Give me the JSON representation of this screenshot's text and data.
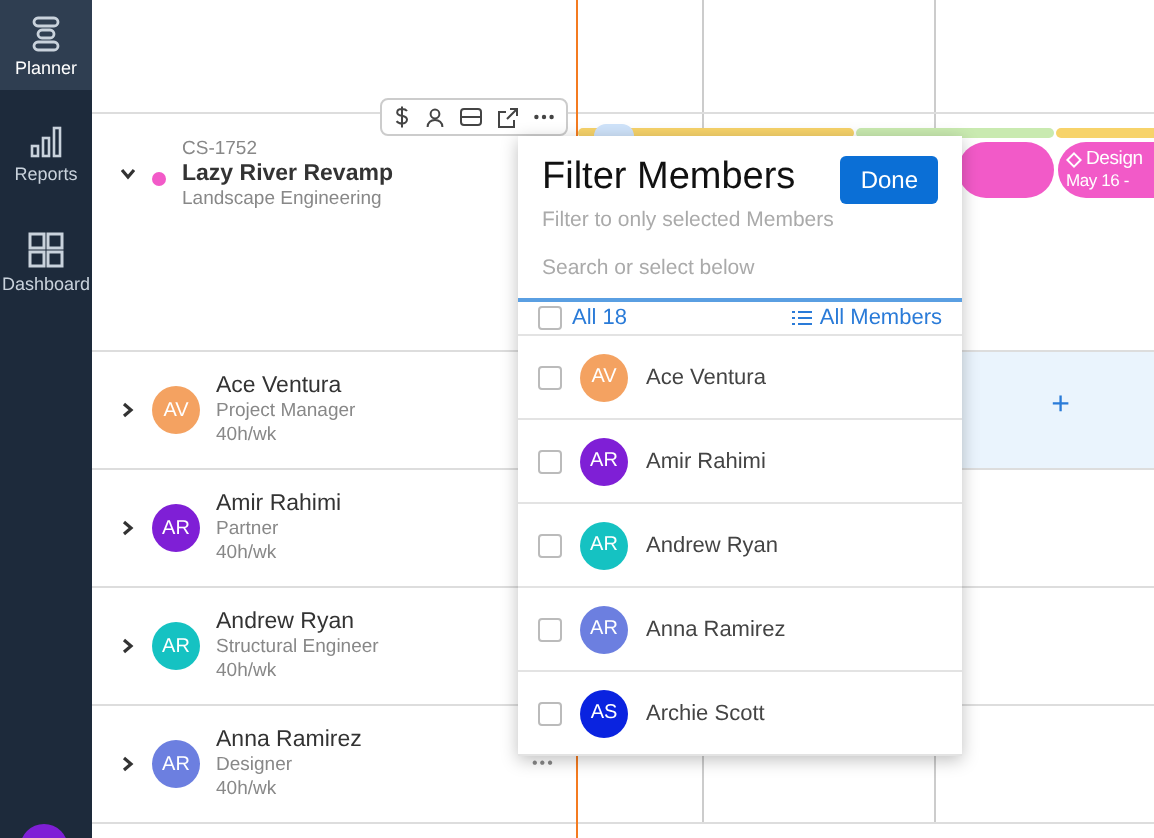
{
  "sidebar": {
    "items": [
      {
        "label": "Planner",
        "kind": "planner",
        "selected": true
      },
      {
        "label": "Reports",
        "kind": "reports",
        "selected": false
      },
      {
        "label": "Dashboard",
        "kind": "dashboard",
        "selected": false
      }
    ]
  },
  "project": {
    "code": "CS-1752",
    "name": "Lazy River Revamp",
    "client": "Landscape Engineering",
    "color": "#f25ac8",
    "expanded": true
  },
  "timeline": {
    "phases": [
      {
        "color": "#f7d36a"
      },
      {
        "color": "#c9eab0"
      },
      {
        "color": "#f7d36a"
      }
    ],
    "schedule_bar": {
      "label": "Design",
      "date": "May 16 -"
    }
  },
  "members": [
    {
      "initials": "AV",
      "name": "Ace Ventura",
      "role": "Project Manager",
      "capacity": "40h/wk",
      "color": "#f4a261",
      "expanded": false,
      "add_label": "+"
    },
    {
      "initials": "AR",
      "name": "Amir Rahimi",
      "role": "Partner",
      "capacity": "40h/wk",
      "color": "#7f1fd6",
      "expanded": false
    },
    {
      "initials": "AR",
      "name": "Andrew Ryan",
      "role": "Structural Engineer",
      "capacity": "40h/wk",
      "color": "#15c2c2",
      "expanded": false
    },
    {
      "initials": "AR",
      "name": "Anna Ramirez",
      "role": "Designer",
      "capacity": "40h/wk",
      "color": "#6c7fe0",
      "expanded": false,
      "more": "•••"
    }
  ],
  "filter": {
    "title": "Filter Members",
    "done": "Done",
    "subtitle": "Filter to only selected Members",
    "placeholder": "Search or select below",
    "all": {
      "label": "All 18",
      "checked": false
    },
    "view": "All Members",
    "options": [
      {
        "initials": "AV",
        "name": "Ace Ventura",
        "color": "#f4a261",
        "checked": false
      },
      {
        "initials": "AR",
        "name": "Amir Rahimi",
        "color": "#7f1fd6",
        "checked": false
      },
      {
        "initials": "AR",
        "name": "Andrew Ryan",
        "color": "#15c2c2",
        "checked": false
      },
      {
        "initials": "AR",
        "name": "Anna Ramirez",
        "color": "#6c7fe0",
        "checked": false
      },
      {
        "initials": "AS",
        "name": "Archie Scott",
        "color": "#0a23e0",
        "checked": false
      }
    ]
  }
}
